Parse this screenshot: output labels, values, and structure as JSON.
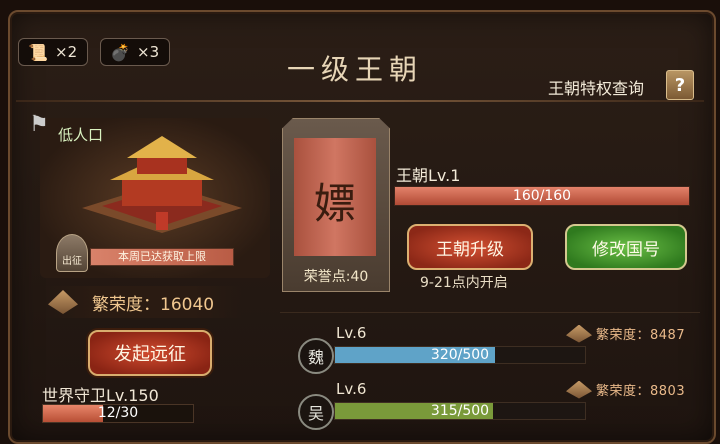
{
  "resources": [
    {
      "icon": "scroll-icon",
      "count": "×2"
    },
    {
      "icon": "bomb-icon",
      "count": "×3"
    }
  ],
  "title": "一级王朝",
  "query_label": "王朝特权查询",
  "query_button": "?",
  "left": {
    "population": "低人口",
    "week_notice": "本周已达获取上限",
    "stamp_text": "出征",
    "prosperity": "繁荣度：16040",
    "expedition_button": "发起远征",
    "guard_label": "世界守卫Lv.150",
    "guard_progress": "12/30",
    "guard_fraction": 0.4
  },
  "dynasty": {
    "banner_char": "嫖",
    "honor": "荣誉点:40",
    "name": "王朝Lv.1",
    "progress": "160/160",
    "upgrade_button": "王朝升级",
    "rename_button": "修改国号",
    "open_time": "9-21点内开启"
  },
  "rivals": [
    {
      "badge": "魏",
      "level": "Lv.6",
      "progress": "320/500",
      "fraction": 0.64,
      "color": "#5fa3c8",
      "prosperity": "繁荣度：8487"
    },
    {
      "badge": "吴",
      "level": "Lv.6",
      "progress": "315/500",
      "fraction": 0.63,
      "color": "#7a9a3a",
      "prosperity": "繁荣度：8803"
    }
  ]
}
